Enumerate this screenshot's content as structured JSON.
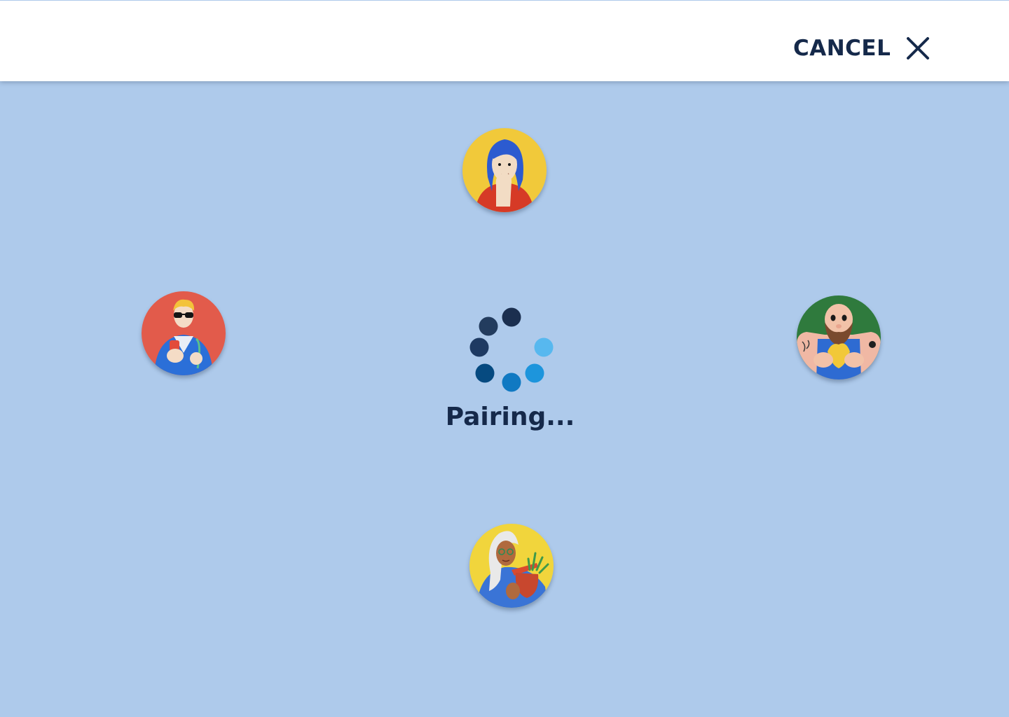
{
  "header": {
    "cancel_label": "CANCEL",
    "close_icon": "close-icon"
  },
  "status": {
    "text": "Pairing..."
  },
  "colors": {
    "background": "#aecaeb",
    "header_bg": "#ffffff",
    "text_dark": "#15294a",
    "spinner_dots": [
      "#1b2f4f",
      "#233c5e",
      "#1e3a62",
      "#064a80",
      "#1079c2",
      "#1d95dc",
      "#57b8ef"
    ]
  },
  "avatars": [
    {
      "name": "avatar-top",
      "icon": "woman-blue-hair-avatar",
      "bg": "#f1c93a"
    },
    {
      "name": "avatar-left",
      "icon": "man-sunglasses-avatar",
      "bg": "#e25b4b"
    },
    {
      "name": "avatar-right",
      "icon": "bearded-man-avatar",
      "bg": "#2f7a3d"
    },
    {
      "name": "avatar-bottom",
      "icon": "woman-plant-pot-avatar",
      "bg": "#f1d53c"
    }
  ]
}
